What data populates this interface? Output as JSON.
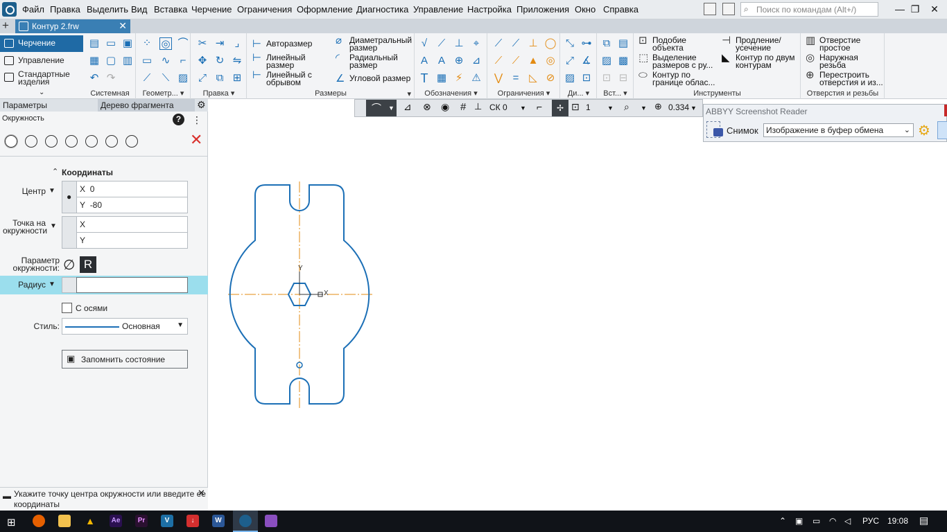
{
  "menubar": {
    "items": [
      "Файл",
      "Правка",
      "Выделить",
      "Вид",
      "Вставка",
      "Черчение",
      "Ограничения",
      "Оформление",
      "Диагностика",
      "Управление",
      "Настройка",
      "Приложения",
      "Окно",
      "Справка"
    ],
    "search_placeholder": "Поиск по командам (Alt+/)"
  },
  "tabbar": {
    "document": "Контур 2.frw"
  },
  "ribbon": {
    "modes": [
      "Черчение",
      "Управление",
      "Стандартные изделия"
    ],
    "groups": [
      "Системная",
      "Геометр...",
      "Правка",
      "Размеры",
      "Обозначения",
      "Ограничения",
      "Ди...",
      "Вст...",
      "Инструменты",
      "Отверстия и резьбы"
    ],
    "sizes": [
      "Авторазмер",
      "Линейный размер",
      "Линейный с обрывом",
      "Диаметральный размер",
      "Радиальный размер",
      "Угловой размер"
    ],
    "tools": [
      "Подобие объекта",
      "Выделение размеров с ру...",
      "Контур по границе облас...",
      "Продление/ усечение",
      "Контур по двум контурам"
    ],
    "holes": [
      "Отверстие простое",
      "Наружная резьба",
      "Перестроить отверстия и из..."
    ]
  },
  "panel": {
    "tabs": [
      "Параметры",
      "Дерево фрагмента"
    ],
    "command": "Окружность",
    "section": "Координаты",
    "center_label": "Центр",
    "center": {
      "x_label": "X",
      "x": "0",
      "y_label": "Y",
      "y": "-80"
    },
    "point_label": "Точка на окружности",
    "point": {
      "x_label": "X",
      "y_label": "Y"
    },
    "param_label": "Параметр окружности:",
    "param_r": "R",
    "radius_label": "Радиус",
    "axes_label": "С осями",
    "style_label": "Стиль:",
    "style_value": "Основная",
    "save_state": "Запомнить состояние",
    "status": "Укажите точку центра окружности или введите ее координаты"
  },
  "canvas_toolbar": {
    "cs": "СК 0",
    "layer": "1",
    "zoom": "0.334"
  },
  "abbyy": {
    "title": "ABBYY Screenshot Reader",
    "snap": "Снимок",
    "target": "Изображение в буфер обмена"
  },
  "drawing": {
    "y_axis": "Y",
    "x_axis": "X"
  },
  "taskbar": {
    "lang": "РУС",
    "time": "19:08"
  }
}
